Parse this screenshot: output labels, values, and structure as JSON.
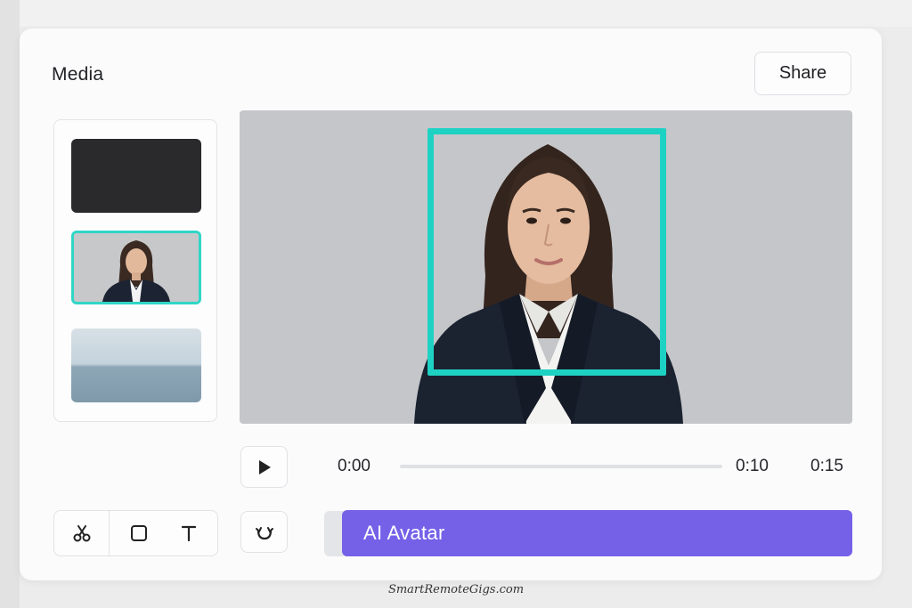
{
  "header": {
    "title": "Media",
    "share_label": "Share"
  },
  "library": {
    "items": [
      {
        "kind": "blank-dark-clip"
      },
      {
        "kind": "avatar-clip",
        "selected": true
      },
      {
        "kind": "ocean-clip"
      }
    ]
  },
  "playback": {
    "current_time": "0:00",
    "mid_time": "0:10",
    "end_time": "0:15",
    "progress": 0
  },
  "timeline": {
    "clip_label": "AI Avatar"
  },
  "watermark": "SmartRemoteGigs.com",
  "colors": {
    "accent_teal": "#1ed2c3",
    "clip_purple": "#7461e8",
    "preview_bg": "#c5c6c9"
  },
  "icons": {
    "play": "play-icon",
    "cut": "scissors-icon",
    "shape": "square-icon",
    "text": "text-icon",
    "undo": "rotate-icon"
  }
}
